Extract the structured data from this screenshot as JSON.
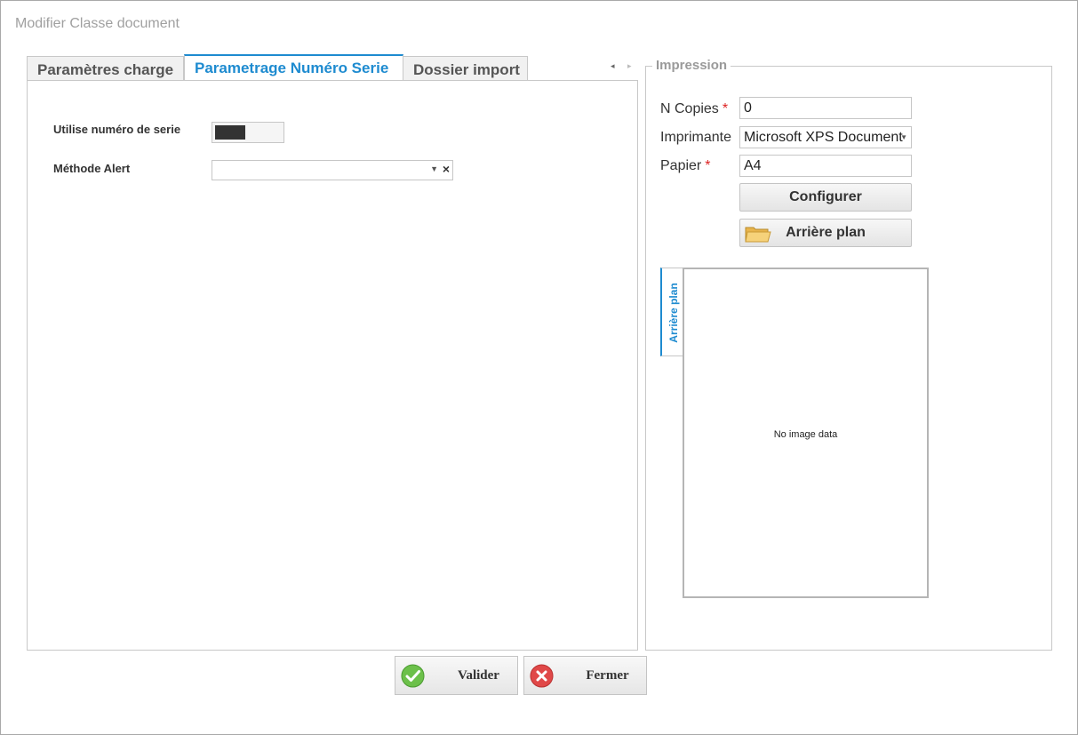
{
  "window": {
    "title": "Modifier Classe document"
  },
  "tabs": [
    {
      "label": "Paramètres charge"
    },
    {
      "label": "Parametrage Numéro Serie"
    },
    {
      "label": "Dossier import"
    }
  ],
  "tab_nav": {
    "prev": "◂",
    "next": "▸"
  },
  "serie_form": {
    "use_serial_label": "Utilise numéro de serie",
    "use_serial_value": false,
    "alert_method_label": "Méthode Alert",
    "alert_method_value": ""
  },
  "impression": {
    "title": "Impression",
    "copies_label": "N Copies",
    "copies_value": "0",
    "printer_label": "Imprimante",
    "printer_value": "Microsoft XPS Document",
    "paper_label": "Papier",
    "paper_value": "A4",
    "required_mark": "*",
    "configure_button": "Configurer",
    "background_button": "Arrière plan",
    "preview_tab": "Arrière plan",
    "no_image": "No image data"
  },
  "footer": {
    "validate_label": "Valider",
    "close_label": "Fermer"
  },
  "colors": {
    "accent": "#1e8bd0",
    "required": "#dd2222",
    "validate_icon": "#5cb85c",
    "close_icon": "#d9534f"
  }
}
